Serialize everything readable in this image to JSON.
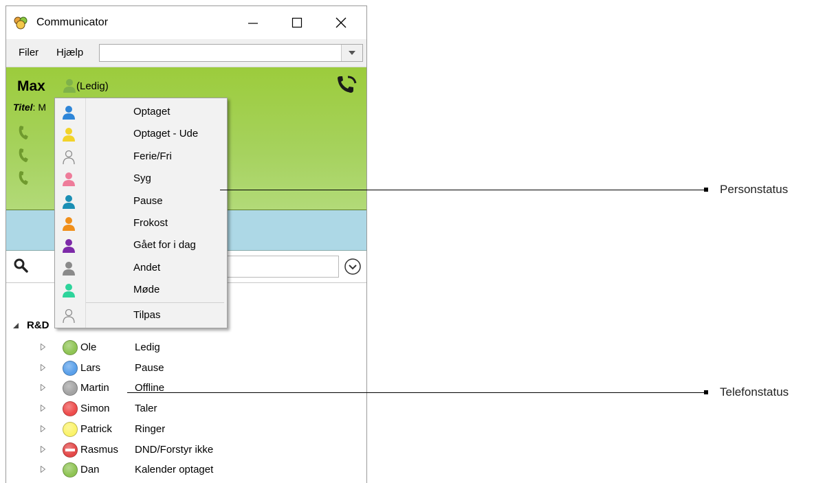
{
  "window": {
    "title": "Communicator"
  },
  "menubar": {
    "items": [
      "Filer",
      "Hjælp"
    ],
    "combo_value": ""
  },
  "user": {
    "name": "Max",
    "status": "(Ledig)",
    "titel_label": "Titel",
    "titel_value": "M"
  },
  "status_menu": {
    "items": [
      {
        "label": "Optaget",
        "color": "#2f86d8"
      },
      {
        "label": "Optaget - Ude",
        "color": "#f2d32a"
      },
      {
        "label": "Ferie/Fri",
        "color": "outline"
      },
      {
        "label": "Syg",
        "color": "#ee7c9a"
      },
      {
        "label": "Pause",
        "color": "#1b8fb4"
      },
      {
        "label": "Frokost",
        "color": "#f08f1a"
      },
      {
        "label": "Gået for i dag",
        "color": "#7d2aa8"
      },
      {
        "label": "Andet",
        "color": "#8a8a8a"
      },
      {
        "label": "Møde",
        "color": "#2ed49b"
      }
    ],
    "custom_label": "Tilpas"
  },
  "tree": {
    "group": "R&D",
    "rows": [
      {
        "name": "Ole",
        "status": "Ledig",
        "color": "#8fc454"
      },
      {
        "name": "Lars",
        "status": "Pause",
        "color": "#5aa0ea"
      },
      {
        "name": "Martin",
        "status": "Offline",
        "color": "#a3a3a3"
      },
      {
        "name": "Simon",
        "status": "Taler",
        "color": "#ee4c4c"
      },
      {
        "name": "Patrick",
        "status": "Ringer",
        "color": "#fbf36a"
      },
      {
        "name": "Rasmus",
        "status": "DND/Forstyr ikke",
        "color": "#e44848"
      },
      {
        "name": "Dan",
        "status": "Kalender optaget",
        "color": "#8fc454"
      }
    ]
  },
  "callouts": {
    "person": "Personstatus",
    "telefon": "Telefonstatus"
  }
}
